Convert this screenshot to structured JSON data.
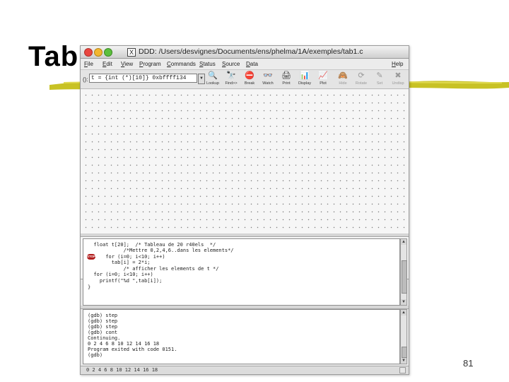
{
  "slide": {
    "title": "Tab",
    "page_number": "81"
  },
  "window": {
    "title": "DDD: /Users/desvignes/Documents/ens/phelma/1A/exemples/tab1.c",
    "x_icon": "x11-icon"
  },
  "menubar": {
    "items": [
      "File",
      "Edit",
      "View",
      "Program",
      "Commands",
      "Status",
      "Source",
      "Data"
    ],
    "help": "Help"
  },
  "toolbar": {
    "arg_label": "():",
    "arg_value": "t = {int (*)[10]} 0xbffff134",
    "tools": [
      {
        "label": "Lookup",
        "icon": "lookup-icon",
        "glyph": "🔍",
        "enabled": true
      },
      {
        "label": "Find>>",
        "icon": "find-icon",
        "glyph": "🔭",
        "enabled": true
      },
      {
        "label": "Break",
        "icon": "break-icon",
        "glyph": "⛔",
        "enabled": true
      },
      {
        "label": "Watch",
        "icon": "watch-icon",
        "glyph": "👓",
        "enabled": true
      },
      {
        "label": "Print",
        "icon": "print-icon",
        "glyph": "🖨",
        "enabled": true
      },
      {
        "label": "Display",
        "icon": "display-icon",
        "glyph": "📊",
        "enabled": true
      },
      {
        "label": "Plot",
        "icon": "plot-icon",
        "glyph": "📈",
        "enabled": true
      },
      {
        "label": "Hide",
        "icon": "hide-icon",
        "glyph": "🙈",
        "enabled": false
      },
      {
        "label": "Rotate",
        "icon": "rotate-icon",
        "glyph": "⟳",
        "enabled": false
      },
      {
        "label": "Set",
        "icon": "set-icon",
        "glyph": "✎",
        "enabled": false
      },
      {
        "label": "Undisp",
        "icon": "undisplay-icon",
        "glyph": "✖",
        "enabled": false
      }
    ]
  },
  "source": {
    "lines": [
      "  float t[20];  /* Tableau de 20 r40els  */",
      "            /*Mettre 0,2,4,6..dans les elements*/",
      "      for (i=0; i<10; i++)",
      "        tab[i] = 2*i;",
      "            /* afficher les elements de t */",
      "  for (i=0; i<10; i++)",
      "    printf(\"%d \",tab[i]);",
      "}"
    ],
    "breakpoint_label": "STOP"
  },
  "console": {
    "lines": [
      "(gdb) step",
      "(gdb) step",
      "(gdb) step",
      "(gdb) cont",
      "Continuing.",
      "0 2 4 6 8 10 12 14 16 18",
      "Program exited with code 0151.",
      "(gdb)"
    ]
  },
  "status": {
    "text": "0 2 4 6 8 10 12 14 16 18"
  },
  "colors": {
    "title_bar": "#cfcfcf",
    "brush": "#c8c224",
    "breakpoint": "#b11d1d"
  }
}
